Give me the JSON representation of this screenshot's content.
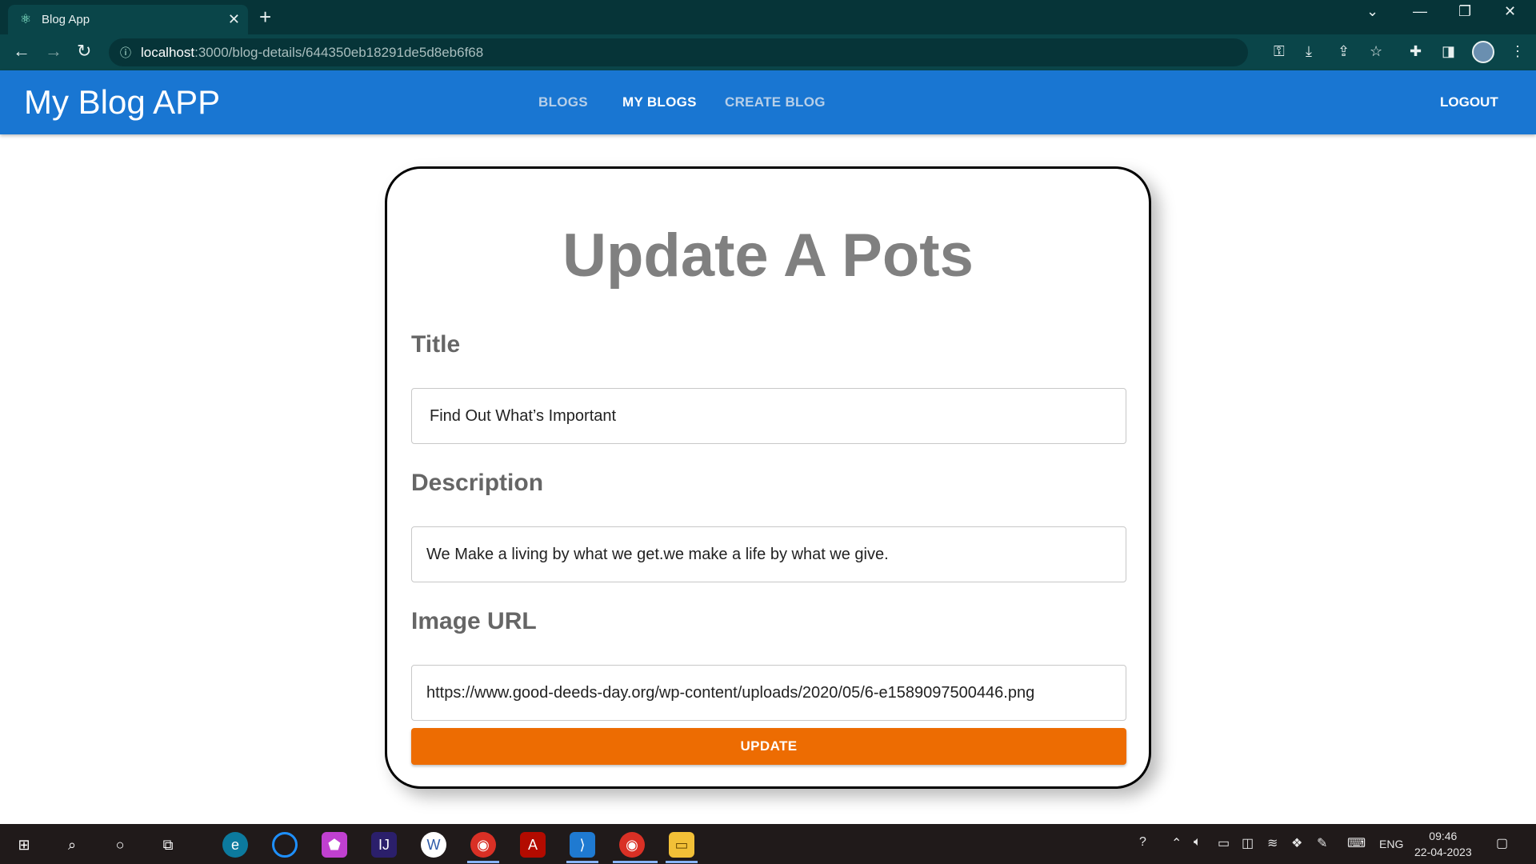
{
  "browser": {
    "tab_title": "Blog App",
    "url_host": "localhost",
    "url_path": ":3000/blog-details/644350eb18291de5d8eb6f68"
  },
  "header": {
    "brand": "My Blog APP",
    "nav": [
      {
        "label": "BLOGS"
      },
      {
        "label": "MY BLOGS"
      },
      {
        "label": "CREATE BLOG"
      }
    ],
    "logout": "LOGOUT",
    "accent": "#1976d2"
  },
  "form": {
    "heading": "Update A Pots",
    "title_label": "Title",
    "title_value": "Find Out What’s Important",
    "description_label": "Description",
    "description_value": "We Make a living by what we get.we make a life by what we give.",
    "image_label": "Image URL",
    "image_value": "https://www.good-deeds-day.org/wp-content/uploads/2020/05/6-e1589097500446.png",
    "submit_label": "UPDATE",
    "button_color": "#ed6c02"
  },
  "taskbar": {
    "language": "ENG",
    "time": "09:46",
    "date": "22-04-2023"
  }
}
